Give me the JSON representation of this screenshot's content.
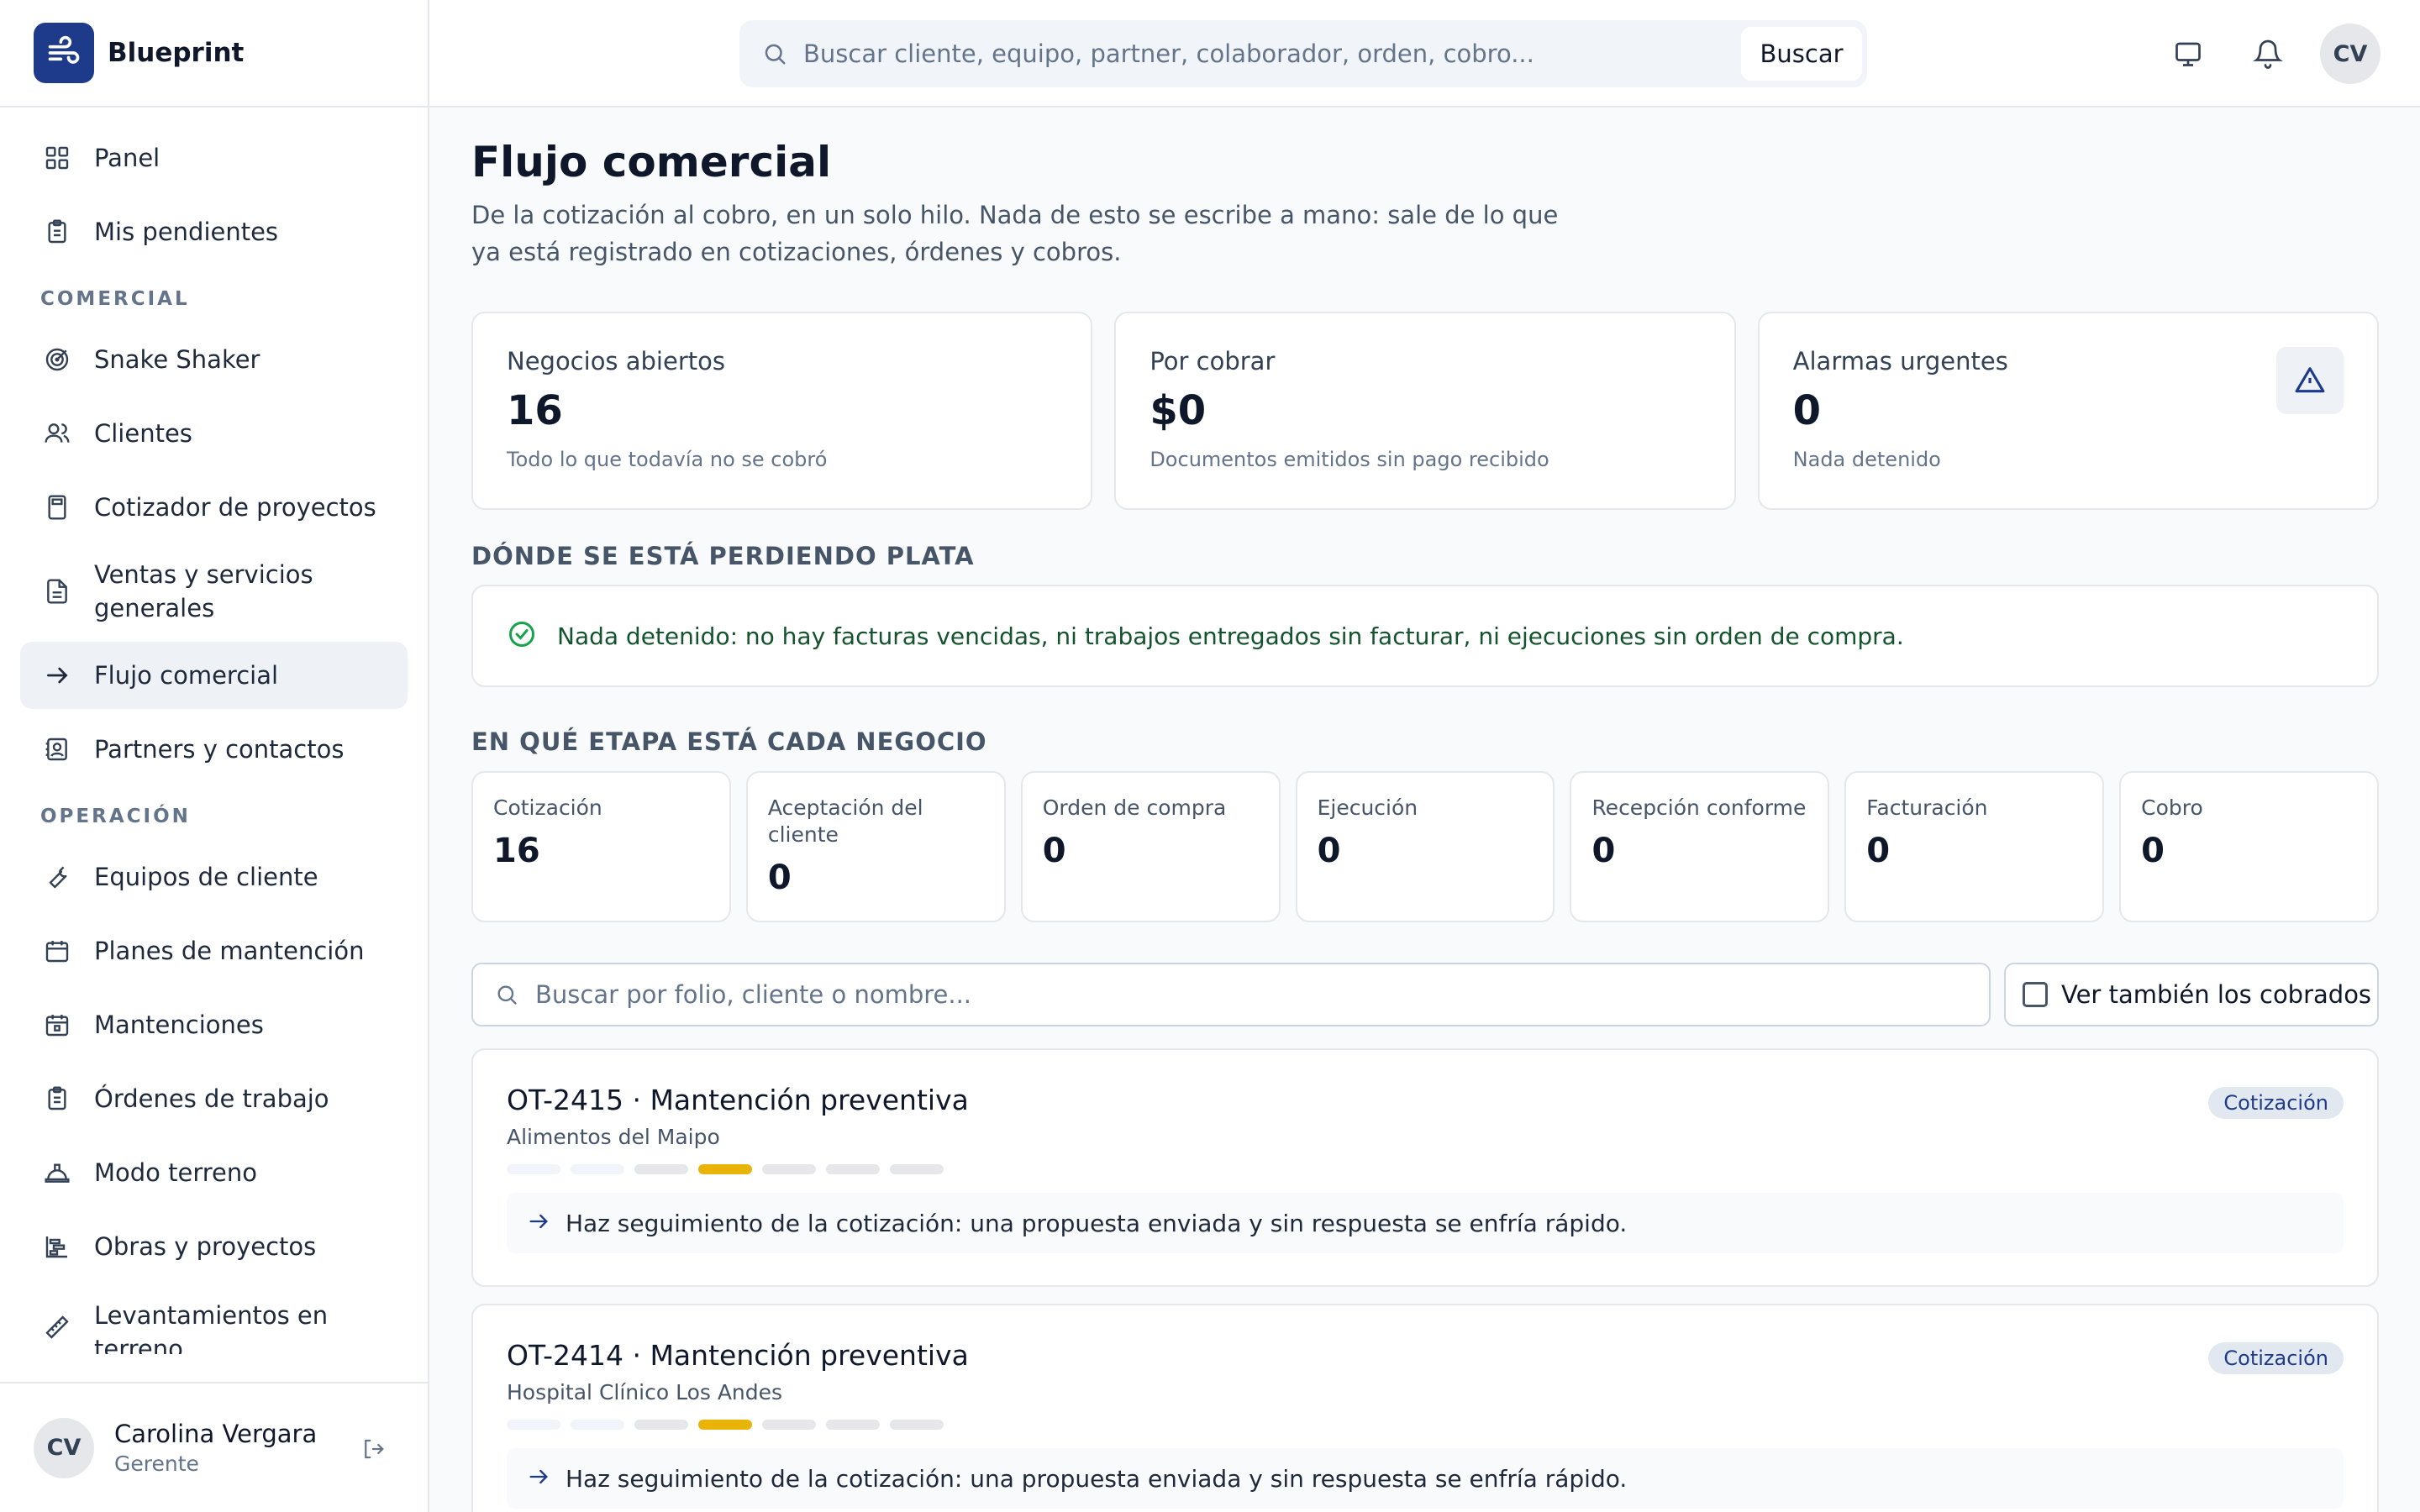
{
  "brand": {
    "name": "Blueprint"
  },
  "sidebar": {
    "items_top": [
      {
        "label": "Panel",
        "icon": "grid-icon"
      },
      {
        "label": "Mis pendientes",
        "icon": "clipboard-icon"
      }
    ],
    "section_comercial": "COMERCIAL",
    "items_comercial": [
      {
        "label": "Snake Shaker",
        "icon": "target-icon"
      },
      {
        "label": "Clientes",
        "icon": "users-icon"
      },
      {
        "label": "Cotizador de proyectos",
        "icon": "calculator-icon"
      },
      {
        "label": "Ventas y servicios generales",
        "icon": "document-icon"
      },
      {
        "label": "Flujo comercial",
        "icon": "arrow-right-icon",
        "active": true
      },
      {
        "label": "Partners y contactos",
        "icon": "contact-icon"
      }
    ],
    "section_operacion": "OPERACIÓN",
    "items_operacion": [
      {
        "label": "Equipos de cliente",
        "icon": "wrench-icon"
      },
      {
        "label": "Planes de mantención",
        "icon": "calendar-grid-icon"
      },
      {
        "label": "Mantenciones",
        "icon": "calendar-icon"
      },
      {
        "label": "Órdenes de trabajo",
        "icon": "clipboard-icon"
      },
      {
        "label": "Modo terreno",
        "icon": "hardhat-icon"
      },
      {
        "label": "Obras y proyectos",
        "icon": "gantt-icon"
      },
      {
        "label": "Levantamientos en terreno",
        "icon": "ruler-icon"
      }
    ],
    "user": {
      "initials": "CV",
      "name": "Carolina Vergara",
      "role": "Gerente"
    }
  },
  "topbar": {
    "search_placeholder": "Buscar cliente, equipo, partner, colaborador, orden, cobro...",
    "search_button": "Buscar",
    "avatar_initials": "CV"
  },
  "page": {
    "title": "Flujo comercial",
    "description": "De la cotización al cobro, en un solo hilo. Nada de esto se escribe a mano: sale de lo que ya está registrado en cotizaciones, órdenes y cobros."
  },
  "stats": [
    {
      "label": "Negocios abiertos",
      "value": "16",
      "sub": "Todo lo que todavía no se cobró"
    },
    {
      "label": "Por cobrar",
      "value": "$0",
      "sub": "Documentos emitidos sin pago recibido"
    },
    {
      "label": "Alarmas urgentes",
      "value": "0",
      "sub": "Nada detenido"
    }
  ],
  "losses": {
    "title": "DÓNDE SE ESTÁ PERDIENDO PLATA",
    "message": "Nada detenido: no hay facturas vencidas, ni trabajos entregados sin facturar, ni ejecuciones sin orden de compra."
  },
  "stages": {
    "title": "EN QUÉ ETAPA ESTÁ CADA NEGOCIO",
    "items": [
      {
        "label": "Cotización",
        "value": "16"
      },
      {
        "label": "Aceptación del cliente",
        "value": "0"
      },
      {
        "label": "Orden de compra",
        "value": "0"
      },
      {
        "label": "Ejecución",
        "value": "0"
      },
      {
        "label": "Recepción conforme",
        "value": "0"
      },
      {
        "label": "Facturación",
        "value": "0"
      },
      {
        "label": "Cobro",
        "value": "0"
      }
    ]
  },
  "filter": {
    "placeholder": "Buscar por folio, cliente o nombre...",
    "toggle_label": "Ver también los cobrados"
  },
  "deals": [
    {
      "title": "OT-2415 · Mantención preventiva",
      "client": "Alimentos del Maipo",
      "badge": "Cotización",
      "stage_index": 3,
      "hint": "Haz seguimiento de la cotización: una propuesta enviada y sin respuesta se enfría rápido."
    },
    {
      "title": "OT-2414 · Mantención preventiva",
      "client": "Hospital Clínico Los Andes",
      "badge": "Cotización",
      "stage_index": 3,
      "hint": "Haz seguimiento de la cotización: una propuesta enviada y sin respuesta se enfría rápido."
    }
  ],
  "colors": {
    "accent": "#1e3a8a",
    "progress": "#eab308",
    "success": "#16a34a"
  }
}
